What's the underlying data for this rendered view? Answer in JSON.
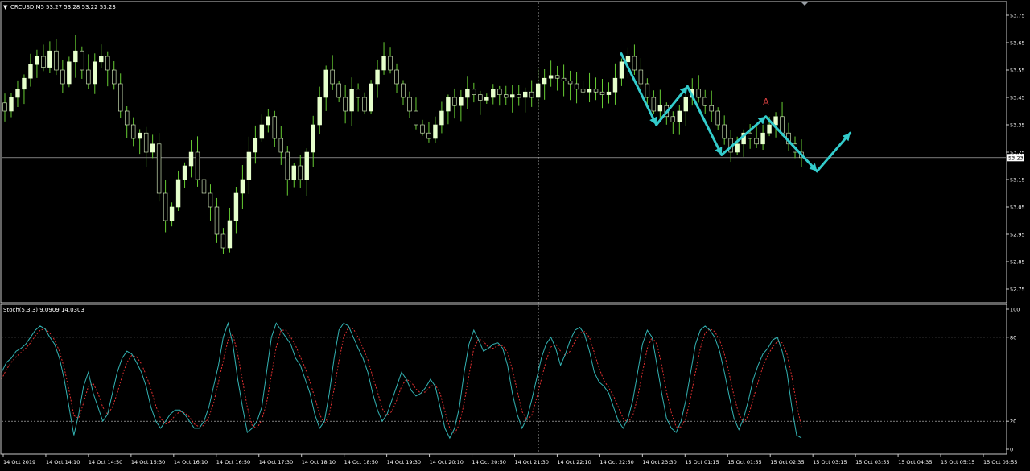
{
  "header": {
    "menu_glyph": "▼",
    "symbol": "CRCUSD,M5",
    "ohlc": "53.27 53.28 53.22 53.23"
  },
  "colors": {
    "background": "#000000",
    "panel_border": "#c8c8c8",
    "grid": "#c8c8c8",
    "bull": "#e6ffcc",
    "bear": "#e6ffcc",
    "wick": "#66cc33",
    "arrow": "#33cccc",
    "label_a": "#d94040",
    "stoch_main": "#33b3b3",
    "stoch_signal": "#e03030",
    "text": "#ffffff"
  },
  "chart_data": [
    {
      "type": "candlestick",
      "title": "CRCUSD,M5",
      "current_price": 53.23,
      "current_price_label": "53.23",
      "ylim": [
        52.7,
        53.8
      ],
      "y_ticks": [
        "53.75",
        "53.65",
        "53.55",
        "53.45",
        "53.35",
        "53.25",
        "53.15",
        "53.05",
        "52.95",
        "52.85",
        "52.75"
      ],
      "x_ticks": [
        "14 Oct 2019",
        "14 Oct 14:10",
        "14 Oct 14:50",
        "14 Oct 15:30",
        "14 Oct 16:10",
        "14 Oct 16:50",
        "14 Oct 17:30",
        "14 Oct 18:10",
        "14 Oct 18:50",
        "14 Oct 19:30",
        "14 Oct 20:10",
        "14 Oct 20:50",
        "14 Oct 21:30",
        "14 Oct 22:10",
        "14 Oct 22:50",
        "14 Oct 23:30",
        "15 Oct 01:15",
        "15 Oct 01:55",
        "15 Oct 02:35",
        "15 Oct 03:15",
        "15 Oct 03:55",
        "15 Oct 04:35",
        "15 Oct 05:15",
        "15 Oct 05:55"
      ],
      "close_path": [
        53.4,
        53.45,
        53.48,
        53.52,
        53.57,
        53.6,
        53.56,
        53.62,
        53.55,
        53.5,
        53.58,
        53.62,
        53.55,
        53.5,
        53.58,
        53.6,
        53.55,
        53.5,
        53.4,
        53.35,
        53.3,
        53.32,
        53.25,
        53.28,
        53.1,
        53.0,
        53.05,
        53.15,
        53.2,
        53.25,
        53.15,
        53.1,
        53.05,
        52.95,
        52.9,
        53.0,
        53.1,
        53.15,
        53.25,
        53.3,
        53.35,
        53.38,
        53.3,
        53.25,
        53.15,
        53.2,
        53.15,
        53.25,
        53.35,
        53.45,
        53.55,
        53.5,
        53.45,
        53.4,
        53.48,
        53.45,
        53.4,
        53.5,
        53.55,
        53.6,
        53.55,
        53.5,
        53.45,
        53.4,
        53.35,
        53.32,
        53.3,
        53.35,
        53.4,
        53.45,
        53.42,
        53.45,
        53.48,
        53.46,
        53.44,
        53.45,
        53.48,
        53.46,
        53.45,
        53.46,
        53.45,
        53.47,
        53.45,
        53.5,
        53.52,
        53.53,
        53.52,
        53.51,
        53.5,
        53.48,
        53.47,
        53.48,
        53.47,
        53.46,
        53.47,
        53.52,
        53.58,
        53.6,
        53.55,
        53.5,
        53.45,
        53.4,
        53.42,
        53.38,
        53.36,
        53.4,
        53.45,
        53.48,
        53.45,
        53.42,
        53.4,
        53.35,
        53.3,
        53.25,
        53.28,
        53.32,
        53.3,
        53.28,
        53.32,
        53.35,
        53.38,
        53.32,
        53.28,
        53.25,
        53.23
      ],
      "pattern_arrows": [
        [
          [
            53.61,
            0.617
          ],
          [
            53.35,
            0.652
          ]
        ],
        [
          [
            53.35,
            0.652
          ],
          [
            53.49,
            0.683
          ]
        ],
        [
          [
            53.49,
            0.683
          ],
          [
            53.24,
            0.717
          ]
        ],
        [
          [
            53.24,
            0.717
          ],
          [
            53.38,
            0.761
          ]
        ],
        [
          [
            53.38,
            0.761
          ],
          [
            53.18,
            0.812
          ]
        ],
        [
          [
            53.18,
            0.812
          ],
          [
            53.32,
            0.845
          ]
        ]
      ],
      "pattern_label": "A",
      "pattern_label_at": [
        53.42,
        0.761
      ]
    },
    {
      "type": "line",
      "title": "Stoch(5,3,3) 9.0909 14.0303",
      "ylim": [
        0,
        100
      ],
      "y_ticks": [
        "100",
        "80",
        "20",
        "0"
      ],
      "levels": [
        80,
        20
      ],
      "series": [
        {
          "values": [
            55,
            62,
            65,
            70,
            72,
            75,
            80,
            85,
            88,
            86,
            80,
            75,
            65,
            50,
            30,
            10,
            25,
            45,
            55,
            40,
            30,
            20,
            25,
            40,
            55,
            65,
            70,
            68,
            62,
            55,
            45,
            30,
            20,
            15,
            20,
            25,
            28,
            28,
            25,
            20,
            15,
            15,
            20,
            30,
            45,
            60,
            80,
            90,
            75,
            50,
            30,
            12,
            15,
            20,
            30,
            55,
            80,
            90,
            85,
            80,
            75,
            65,
            60,
            50,
            40,
            25,
            15,
            20,
            40,
            65,
            85,
            90,
            88,
            80,
            72,
            65,
            55,
            40,
            28,
            20,
            25,
            35,
            45,
            55,
            50,
            42,
            38,
            40,
            44,
            50,
            45,
            30,
            15,
            8,
            15,
            30,
            55,
            75,
            85,
            78,
            70,
            72,
            75,
            76,
            72,
            60,
            40,
            25,
            15,
            22,
            35,
            50,
            65,
            75,
            80,
            72,
            60,
            68,
            78,
            85,
            87,
            82,
            70,
            55,
            48,
            45,
            40,
            30,
            20,
            15,
            22,
            35,
            55,
            75,
            85,
            80,
            60,
            40,
            22,
            15,
            12,
            20,
            35,
            55,
            75,
            85,
            88,
            85,
            80,
            70,
            55,
            38,
            22,
            14,
            22,
            35,
            50,
            60,
            68,
            72,
            78,
            80,
            70,
            55,
            30,
            10,
            8
          ]
        },
        {
          "values": [
            50,
            57,
            62,
            66,
            69,
            72,
            76,
            81,
            85,
            86,
            83,
            78,
            70,
            58,
            42,
            24,
            22,
            33,
            45,
            47,
            40,
            30,
            25,
            30,
            40,
            52,
            62,
            67,
            66,
            61,
            53,
            43,
            31,
            22,
            18,
            20,
            24,
            27,
            26,
            23,
            18,
            16,
            17,
            23,
            33,
            48,
            63,
            78,
            82,
            68,
            49,
            30,
            17,
            15,
            21,
            33,
            53,
            73,
            85,
            85,
            80,
            74,
            66,
            58,
            48,
            37,
            25,
            18,
            25,
            43,
            63,
            80,
            87,
            86,
            80,
            72,
            64,
            52,
            41,
            29,
            24,
            27,
            35,
            45,
            50,
            48,
            43,
            40,
            41,
            45,
            46,
            40,
            27,
            15,
            11,
            18,
            33,
            53,
            72,
            79,
            77,
            73,
            72,
            74,
            74,
            69,
            57,
            42,
            27,
            21,
            24,
            36,
            50,
            63,
            73,
            75,
            70,
            67,
            70,
            77,
            83,
            84,
            80,
            69,
            58,
            49,
            44,
            38,
            30,
            22,
            19,
            24,
            37,
            55,
            72,
            80,
            75,
            60,
            41,
            26,
            16,
            16,
            22,
            37,
            55,
            72,
            83,
            86,
            84,
            78,
            68,
            54,
            38,
            25,
            19,
            24,
            36,
            48,
            59,
            67,
            73,
            77,
            76,
            68,
            52,
            32,
            16
          ]
        }
      ]
    }
  ]
}
